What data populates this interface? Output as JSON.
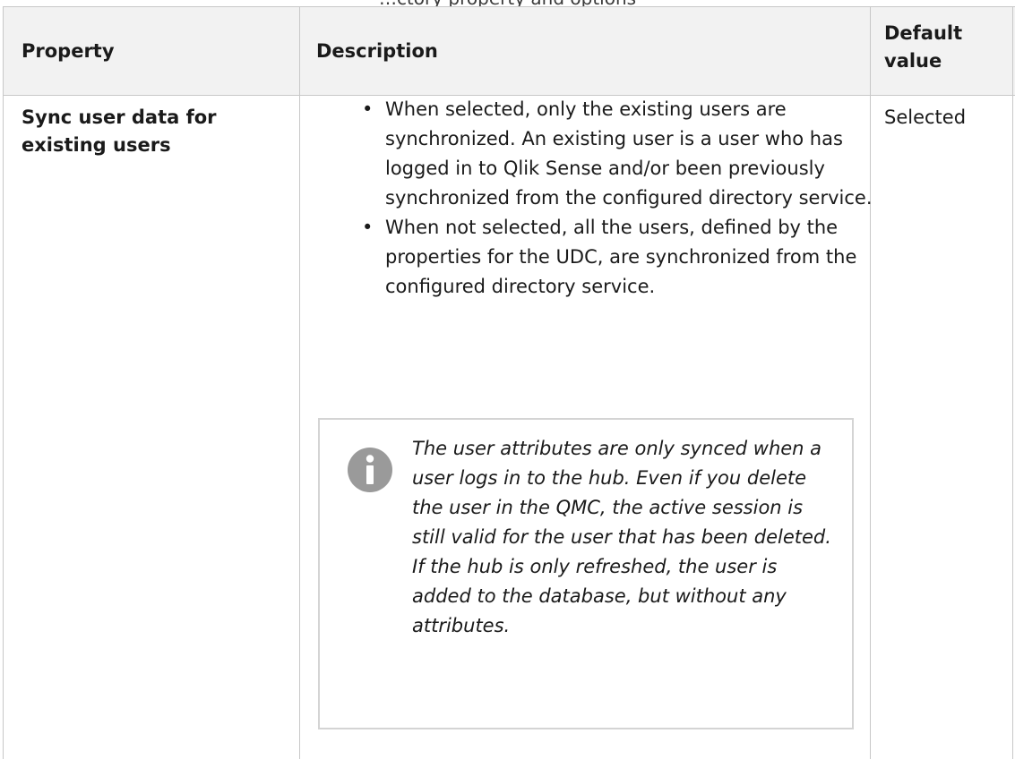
{
  "caption": "…ctory property and options",
  "table": {
    "headers": {
      "property": "Property",
      "description": "Description",
      "default": "Default value"
    },
    "rows": [
      {
        "property": "Sync user data for existing users",
        "description_items": [
          "When selected, only the existing users are synchronized. An existing user is a user who has logged in to Qlik Sense and/or been previously synchronized from the configured directory service.",
          "When not selected, all the users, defined by the properties for the UDC, are synchronized from the configured directory service."
        ],
        "note": "The user attributes are only synced when a user logs in to the hub. Even if you delete the user in the QMC, the active session is still valid for the user that has been deleted. If the hub is only refreshed, the user is added to the database, but without any attributes.",
        "note_icon": "info-icon",
        "default": "Selected"
      }
    ]
  },
  "colors": {
    "header_bg": "#f2f2f2",
    "border": "#c8c8c8",
    "icon": "#9a9a9a"
  }
}
